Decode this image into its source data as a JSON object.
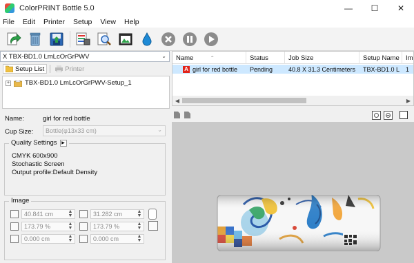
{
  "window": {
    "title": "ColorPRINT Bottle 5.0",
    "controls": {
      "minimize": "—",
      "maximize": "☐",
      "close": "✕"
    }
  },
  "menu": [
    "File",
    "Edit",
    "Printer",
    "Setup",
    "View",
    "Help"
  ],
  "toolbar": {
    "buttons": [
      "refresh-icon",
      "trash-icon",
      "save-icon",
      "print-settings-icon",
      "search-icon",
      "image-icon",
      "ink-drop-icon",
      "cancel-icon",
      "pause-icon",
      "play-icon"
    ]
  },
  "left": {
    "setup_combo": "X TBX-BD1.0 LmLcOrGrPWV",
    "tabs": {
      "setup_list": "Setup List",
      "printer": "Printer"
    },
    "tree_item": "TBX-BD1.0 LmLcOrGrPWV-Setup_1"
  },
  "props": {
    "name_label": "Name:",
    "name_value": "girl for red bottle",
    "cup_size_label": "Cup Size:",
    "cup_size_value": "Bottle(φ13x33 cm)",
    "quality_title": "Quality Settings",
    "quality_lines": [
      "CMYK    600x900",
      "Stochastic Screen",
      "Output profile:Default Density"
    ],
    "image_title": "Image",
    "width": "40.841 cm",
    "height": "31.282 cm",
    "scale_x": "173.79 %",
    "scale_y": "173.79 %",
    "offset_x": "0.000 cm",
    "offset_y": "0.000 cm"
  },
  "jobs": {
    "columns": [
      "Name",
      "Status",
      "Job Size",
      "Setup Name",
      "Im"
    ],
    "rows": [
      {
        "name": "girl for red bottle",
        "status": "Pending",
        "job_size": "40.8 X 31.3 Centimeters",
        "setup_name": "TBX-BD1.0 L",
        "im": "1"
      }
    ]
  },
  "colors": {
    "accent": "#cde8ff",
    "preview_bg": "#c9c9c9",
    "adobe_red": "#e2231a"
  }
}
